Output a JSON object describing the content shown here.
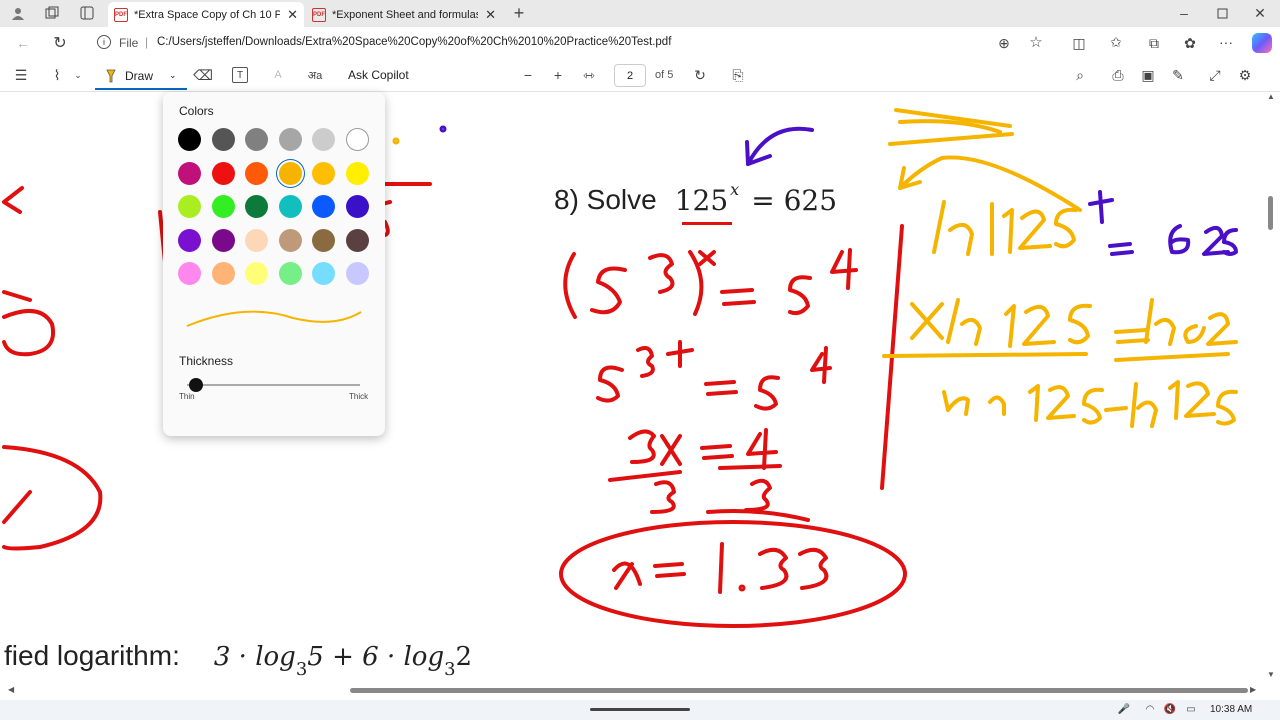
{
  "tabs": [
    {
      "title": "*Extra Space Copy of Ch 10 Practice Test.pdf",
      "active": true
    },
    {
      "title": "*Exponent Sheet and formulas - ",
      "active": false
    }
  ],
  "address": {
    "scheme_label": "File",
    "url": "C:/Users/jsteffen/Downloads/Extra%20Space%20Copy%20of%20Ch%2010%20Practice%20Test.pdf"
  },
  "toolbar": {
    "draw_label": "Draw",
    "ask_copilot_label": "Ask Copilot",
    "page_current": "2",
    "page_total_label": "of 5"
  },
  "draw_popup": {
    "colors_title": "Colors",
    "thickness_title": "Thickness",
    "thin_label": "Thin",
    "thick_label": "Thick",
    "thickness_level": 0.05,
    "selected_color": "#f5b400",
    "colors": [
      [
        "#000000",
        "#555555",
        "#808080",
        "#a6a6a6",
        "#cccccc",
        "#ffffff"
      ],
      [
        "#c0107a",
        "#ee1111",
        "#ff5a0a",
        "#f5b400",
        "#ffbf00",
        "#ffee00"
      ],
      [
        "#aaee22",
        "#33ee22",
        "#0b7a3a",
        "#12bfbf",
        "#0a5aff",
        "#3a10c8"
      ],
      [
        "#7a10d0",
        "#7a0a8a",
        "#fcd7b8",
        "#bf9a7a",
        "#8a6a40",
        "#5a4040"
      ],
      [
        "#ff88ee",
        "#ffb377",
        "#ffff77",
        "#77ee88",
        "#77ddff",
        "#c8c8ff"
      ]
    ]
  },
  "document": {
    "problem_label": "8) Solve",
    "eq_base": "125",
    "eq_exp": "x",
    "eq_rhs": "= 625",
    "bottom_prefix": "fied logarithm:",
    "bottom_expr_a": "3 · log",
    "bottom_sub_a": "3",
    "bottom_expr_b": "5 + 6 · log",
    "bottom_sub_b": "3",
    "bottom_expr_c": "2",
    "handwriting": {
      "step1": "(5³)ˣ = 5⁴",
      "step2": "5³ˣ = 5⁴",
      "step3": "3x = 4",
      "step3_den": "3    3",
      "answer": "x = 1.33",
      "ln1": "ln125ˣ = ln625",
      "ln2": "x ln125 = ln625",
      "ln3": "ln125  ln125"
    }
  },
  "taskbar": {
    "time": "10:38 AM"
  },
  "colors": {
    "red_ink": "#e01010",
    "yellow_ink": "#f5b400",
    "purple_ink": "#4a10c8"
  }
}
